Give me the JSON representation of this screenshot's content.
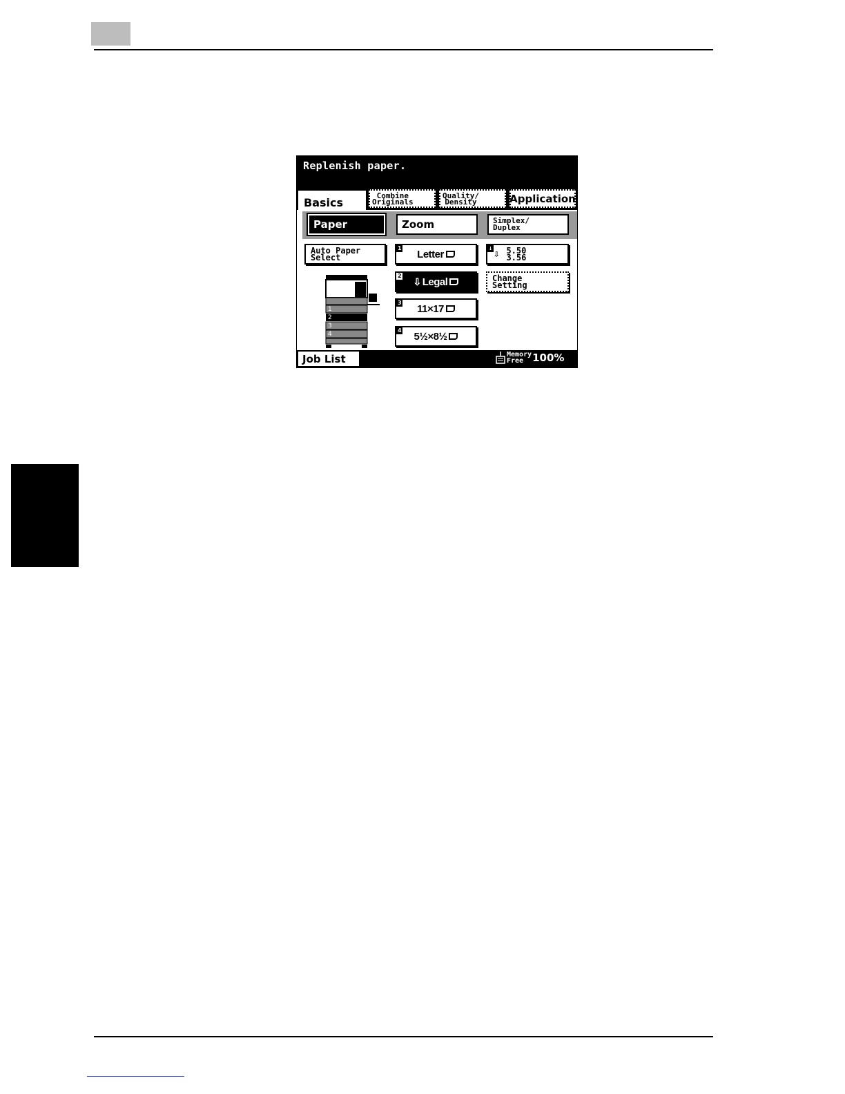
{
  "screen": {
    "message": "Replenish paper.",
    "tabs": [
      {
        "label": "Basics"
      },
      {
        "label": "Combine\nOriginals"
      },
      {
        "label": "Quality/\nDensity"
      },
      {
        "label": "Application"
      }
    ],
    "subtabs": [
      {
        "label": "Paper"
      },
      {
        "label": "Zoom"
      },
      {
        "label": "Simplex/\nDuplex"
      }
    ],
    "buttons": {
      "auto_paper": "Auto Paper\nSelect",
      "tray1": {
        "num": "1",
        "label": "Letter"
      },
      "tray2": {
        "num": "2",
        "label": "Legal"
      },
      "tray3": {
        "num": "3",
        "label": "11×17"
      },
      "tray4": {
        "num": "4",
        "label": "5½×8½"
      },
      "bypass": {
        "line1": "5.50",
        "line2": "3.56"
      },
      "change_setting": "Change\nSetting"
    },
    "tray_diagram_numbers": [
      "1",
      "2",
      "3",
      "4"
    ],
    "status": {
      "job_list": "Job List",
      "memory_label": "Memory\nFree",
      "memory_value": "100%"
    }
  }
}
